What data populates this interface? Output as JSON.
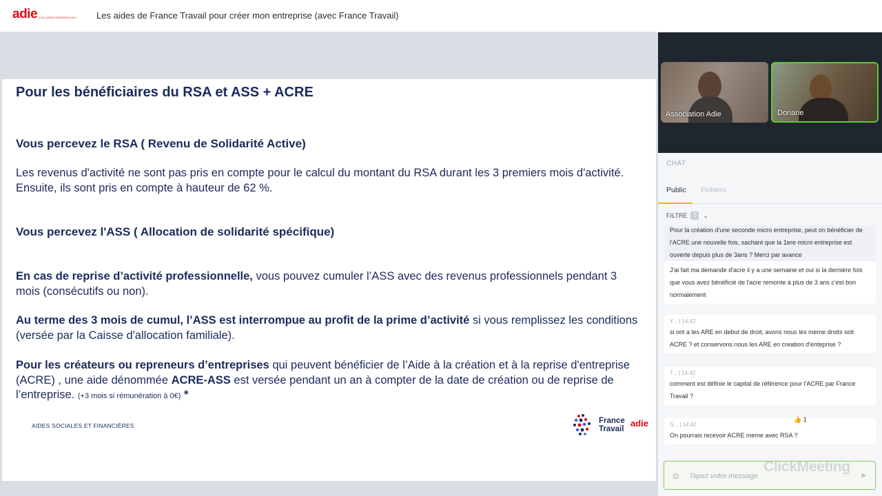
{
  "header": {
    "brand": "adie",
    "brand_sub": "LES WEBCONFÉRENCES",
    "title": "Les aides de France Travail pour créer mon entreprise (avec France Travail)"
  },
  "slide": {
    "title": "Pour les bénéficiaires du RSA et ASS + ACRE",
    "rsa_heading": "Vous percevez le RSA ( Revenu de Solidarité Active)",
    "rsa_text": "Les revenus d'activité ne sont pas pris en compte pour le calcul du montant du RSA durant les 3 premiers mois d'activité. Ensuite, ils sont pris en compte à hauteur de 62 %.",
    "ass_heading": "Vous percevez l'ASS ( Allocation de solidarité spécifique)",
    "p1_bold": "En cas de reprise d’activité professionnelle,",
    "p1_text": " vous pouvez cumuler l’ASS avec des revenus professionnels pendant 3 mois (consécutifs ou non).",
    "p2_bold": "Au terme des 3 mois de cumul, l’ASS est interrompue au profit de la prime d’activité",
    "p2_text": " si vous remplissez les conditions (versée par la Caisse d'allocation familiale).",
    "p3_bold": "Pour les créateurs ou repreneurs d’entreprises",
    "p3_text1": " qui peuvent bénéficier de l’Aide à la création et à la reprise d'entreprise (ACRE) , une aide dénommée ",
    "p3_bold2": "ACRE-ASS",
    "p3_text2": " est versée pendant un an à compter de la date de création ou de reprise de l’entreprise.",
    "p3_small": "(+3 mois si rémunération à 0€)",
    "p3_star": "*",
    "footer": "AIDES SOCIALES ET FINANCIÈRES",
    "ft_line1": "France",
    "ft_line2": "Travail",
    "adie_logo": "adie"
  },
  "videos": [
    {
      "name": "Association Adie"
    },
    {
      "name": "Doriane"
    }
  ],
  "chat": {
    "label": "CHAT",
    "tab_public": "Public",
    "tab_files": "Fichiers",
    "filter_label": "FILTRE",
    "filter_count": "0",
    "messages": [
      {
        "meta": "",
        "text": "Pour la création d'une seconde micro entreprise, peut on bénéficier de l'ACRE une nouvelle fois, sachant que la 1ere micro entreprise est ouverte depuis plus de 3ans ? Merci par avance"
      },
      {
        "meta": "",
        "text": "J'ai fait ma demande d'acre il y a une semaine et oui si la dernière fois que vous avez bénéficié de l'acre remonte à plus de 3 ans c'est bon normalement"
      },
      {
        "meta": "Y... | 14:42",
        "text": "si ont a les ARE en debut de droit, avons nous les meme droits soit ACRE ? et conservons nous les ARE en creation d'enteprise ?"
      },
      {
        "meta": "T... | 14:42",
        "text": "comment est définie le capital de référence pour l'ACRE par France Travail ?"
      },
      {
        "meta": "S... | 14:42",
        "text": "On pourrais recevoir ACRE meme avec RSA ?"
      }
    ],
    "reaction": "👍 1",
    "composer_placeholder": "Tapez votre message",
    "watermark": "ClickMeeting"
  }
}
